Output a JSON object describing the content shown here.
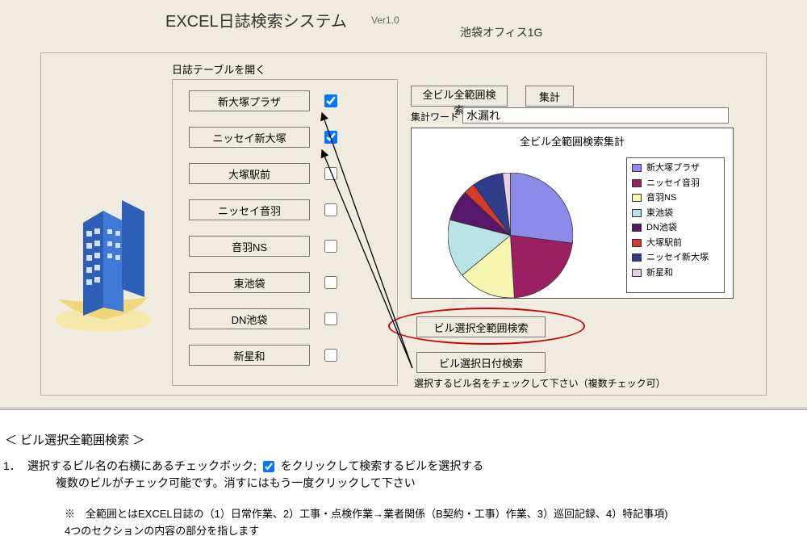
{
  "header": {
    "title": "EXCEL日誌検索システム",
    "version": "Ver1.0",
    "office": "池袋オフィス1G"
  },
  "left": {
    "label": "日誌テーブルを開く",
    "buildings": [
      {
        "label": "新大塚プラザ",
        "checked": true
      },
      {
        "label": "ニッセイ新大塚",
        "checked": true
      },
      {
        "label": "大塚駅前",
        "checked": false
      },
      {
        "label": "ニッセイ音羽",
        "checked": false
      },
      {
        "label": "音羽NS",
        "checked": false
      },
      {
        "label": "東池袋",
        "checked": false
      },
      {
        "label": "DN池袋",
        "checked": false
      },
      {
        "label": "新星和",
        "checked": false
      }
    ]
  },
  "right": {
    "btn_all_search": "全ビル全範囲検索",
    "btn_agg": "集計",
    "agg_word_label": "集計ワード",
    "agg_word_value": "水漏れ",
    "btn_sel_range": "ビル選択全範囲検索",
    "btn_sel_date": "ビル選択日付検索",
    "hint": "選択するビル名をチェックして下さい（複数チェック可）"
  },
  "chart_data": {
    "type": "pie",
    "title": "全ビル全範囲検索集計",
    "series": [
      {
        "name": "新大塚プラザ",
        "value": 27,
        "color": "#8C8CE8"
      },
      {
        "name": "ニッセイ音羽",
        "value": 22,
        "color": "#9C1F63"
      },
      {
        "name": "音羽NS",
        "value": 15,
        "color": "#F6F6B0"
      },
      {
        "name": "東池袋",
        "value": 15,
        "color": "#B9E3E6"
      },
      {
        "name": "DN池袋",
        "value": 8,
        "color": "#57176B"
      },
      {
        "name": "大塚駅前",
        "value": 3,
        "color": "#D83A2A"
      },
      {
        "name": "ニッセイ新大塚",
        "value": 8,
        "color": "#2E3C8C"
      },
      {
        "name": "新星和",
        "value": 2,
        "color": "#E8CFE5"
      }
    ]
  },
  "lower": {
    "section_title": "＜ ビル選択全範囲検索 ＞",
    "step1_num": "1．",
    "step1_a": "選択するビル名の右横にあるチェックボック;",
    "step1_b": "をクリックして検索するビルを選択する",
    "step1_c": "複数のビルがチェック可能です。消すにはもう一度クリックして下さい",
    "note1": "※　全範囲とはEXCEL日誌の（1）日常作業、2）工事・点検作業→業者関係（B契約・工事）作業、3）巡回記録、4）特記事項)",
    "note2": "4つのセクションの内容の部分を指します"
  }
}
